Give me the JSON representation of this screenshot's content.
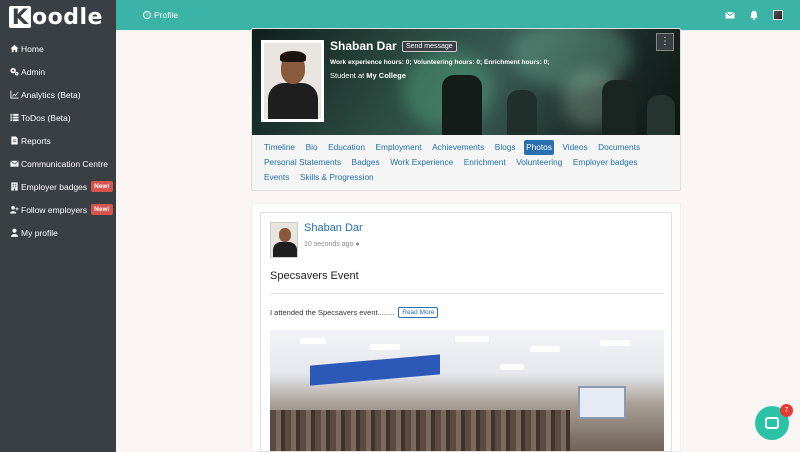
{
  "brand": {
    "logo_k": "K",
    "logo_rest": "oodle"
  },
  "sidebar": {
    "items": [
      {
        "label": "Home",
        "icon": "home-icon"
      },
      {
        "label": "Admin",
        "icon": "cogs-icon"
      },
      {
        "label": "Analytics (Beta)",
        "icon": "chart-icon"
      },
      {
        "label": "ToDos (Beta)",
        "icon": "list-icon"
      },
      {
        "label": "Reports",
        "icon": "file-icon"
      },
      {
        "label": "Communication Centre",
        "icon": "envelope-icon"
      },
      {
        "label": "Employer badges",
        "icon": "building-icon",
        "badge": "New!"
      },
      {
        "label": "Follow employers",
        "icon": "user-plus-icon",
        "badge": "New!"
      },
      {
        "label": "My profile",
        "icon": "user-icon"
      }
    ]
  },
  "topbar": {
    "breadcrumb": "Profile",
    "icons": [
      "envelope-icon",
      "bell-icon",
      "avatar"
    ]
  },
  "profile": {
    "name": "Shaban Dar",
    "send_message": "Send message",
    "hours": "Work experience hours: 0; Volunteering hours: 0; Enrichment hours: 0;",
    "student_prefix": "Student at ",
    "college": "My College",
    "menu": "⋮",
    "tabs": [
      "Timeline",
      "Bio",
      "Education",
      "Employment",
      "Achievements",
      "Blogs",
      "Photos",
      "Videos",
      "Documents",
      "Personal Statements",
      "Badges",
      "Work Experience",
      "Enrichment",
      "Volunteering",
      "Employer badges",
      "Events",
      "Skills & Progression"
    ],
    "active_tab": "Photos"
  },
  "post": {
    "author": "Shaban Dar",
    "time": "10 seconds ago",
    "title": "Specsavers Event",
    "text": "I attended the Specsavers event........",
    "read_more": "Read More"
  },
  "chat": {
    "badge": "7"
  }
}
